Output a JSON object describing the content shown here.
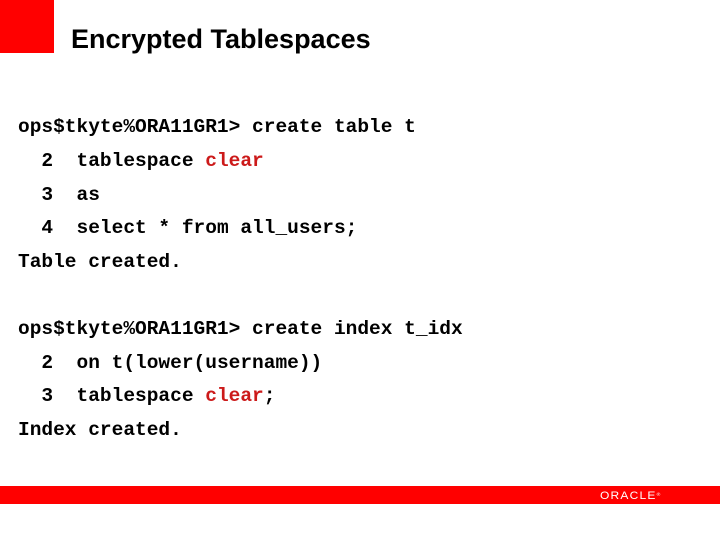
{
  "slide": {
    "title": "Encrypted Tablespaces",
    "accent_color": "#ff0000",
    "highlight_color": "#cc1a1a"
  },
  "block1": {
    "prompt_line": "ops$tkyte%ORA11GR1> create table t",
    "lines": [
      {
        "num": "2",
        "pre": "tablespace ",
        "hl": "clear",
        "post": ""
      },
      {
        "num": "3",
        "pre": "as",
        "hl": "",
        "post": ""
      },
      {
        "num": "4",
        "pre": "select * from all_users;",
        "hl": "",
        "post": ""
      }
    ],
    "result": "Table created."
  },
  "block2": {
    "prompt_line": "ops$tkyte%ORA11GR1> create index t_idx",
    "lines": [
      {
        "num": "2",
        "pre": "on t(lower(username))",
        "hl": "",
        "post": ""
      },
      {
        "num": "3",
        "pre": "tablespace ",
        "hl": "clear",
        "post": ";"
      }
    ],
    "result": "Index created."
  },
  "footer": {
    "logo_text": "ORACLE",
    "logo_mark": "®"
  }
}
